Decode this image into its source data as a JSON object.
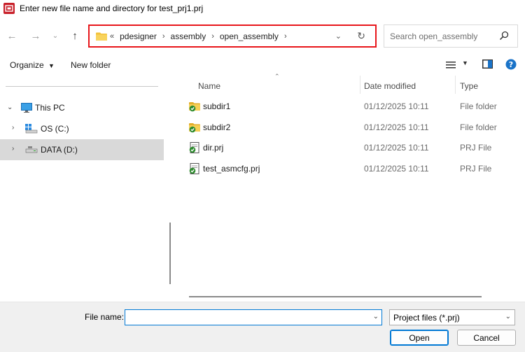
{
  "window": {
    "title": "Enter new file name and directory for test_prj1.prj"
  },
  "navigation": {
    "breadcrumb": [
      "pdesigner",
      "assembly",
      "open_assembly"
    ],
    "overflow_glyph": "«",
    "search_placeholder": "Search open_assembly"
  },
  "toolbar": {
    "organize_label": "Organize",
    "new_folder_label": "New folder"
  },
  "sidebar": {
    "items": [
      {
        "label": "This PC",
        "icon": "monitor-icon",
        "expanded": true
      },
      {
        "label": "OS (C:)",
        "icon": "drive-os-icon",
        "expanded": false
      },
      {
        "label": "DATA (D:)",
        "icon": "drive-data-icon",
        "expanded": false,
        "selected": true
      }
    ]
  },
  "file_list": {
    "columns": [
      "Name",
      "Date modified",
      "Type"
    ],
    "rows": [
      {
        "name": "subdir1",
        "date": "01/12/2025 10:11",
        "type": "File folder",
        "icon": "folder-synced-icon"
      },
      {
        "name": "subdir2",
        "date": "01/12/2025 10:11",
        "type": "File folder",
        "icon": "folder-synced-icon"
      },
      {
        "name": "dir.prj",
        "date": "01/12/2025 10:11",
        "type": "PRJ File",
        "icon": "prj-file-icon"
      },
      {
        "name": "test_asmcfg.prj",
        "date": "01/12/2025 10:11",
        "type": "PRJ File",
        "icon": "prj-file-icon"
      }
    ]
  },
  "footer": {
    "file_name_label": "File name:",
    "file_name_value": "",
    "file_type_selected": "Project files (*.prj)",
    "open_label": "Open",
    "cancel_label": "Cancel"
  },
  "colors": {
    "address_highlight": "#e8161b",
    "accent": "#0078d4",
    "folder": "#f3c13a",
    "sync_check": "#2e8b2e"
  }
}
